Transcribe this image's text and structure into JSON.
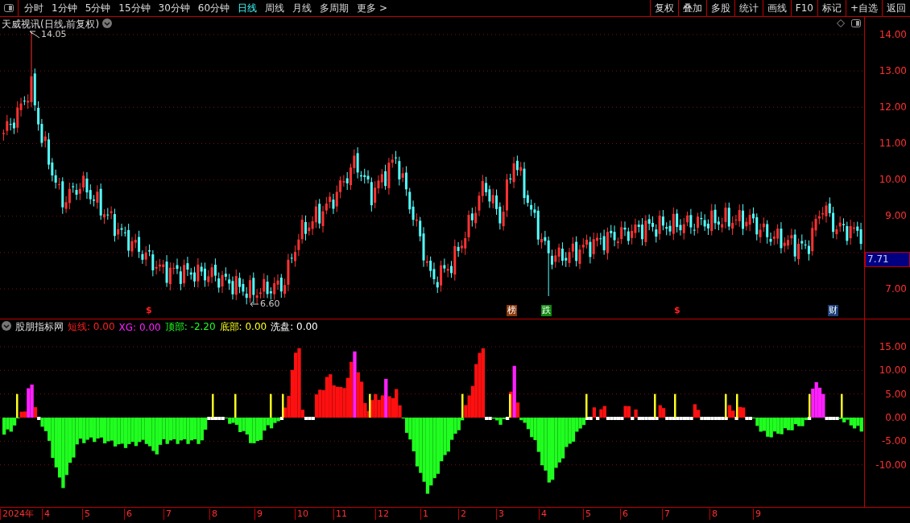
{
  "toolbar": {
    "periods": [
      {
        "label": "分时",
        "selected": false
      },
      {
        "label": "1分钟",
        "selected": false
      },
      {
        "label": "5分钟",
        "selected": false
      },
      {
        "label": "15分钟",
        "selected": false
      },
      {
        "label": "30分钟",
        "selected": false
      },
      {
        "label": "60分钟",
        "selected": false
      },
      {
        "label": "日线",
        "selected": true
      },
      {
        "label": "周线",
        "selected": false
      },
      {
        "label": "月线",
        "selected": false
      },
      {
        "label": "多周期",
        "selected": false
      },
      {
        "label": "更多 >",
        "selected": false
      }
    ],
    "actions": [
      "复权",
      "叠加",
      "多股",
      "统计",
      "画线",
      "F10",
      "标记",
      "+自选",
      "返回"
    ]
  },
  "main_chart": {
    "title": "天威视讯(日线,前复权)",
    "high_label": "14.05",
    "low_label": "6.60",
    "price_ticks": [
      "14.00",
      "13.00",
      "12.00",
      "11.00",
      "10.00",
      "9.00",
      "7.00"
    ],
    "current_price": "7.71",
    "markers": [
      {
        "kind": "sign",
        "text": "$",
        "color": "#ff2020"
      },
      {
        "kind": "badge",
        "text": "榜",
        "color": "#8b3a0c"
      },
      {
        "kind": "badge",
        "text": "跌",
        "color": "#108a10"
      },
      {
        "kind": "sign",
        "text": "$",
        "color": "#ff2020"
      },
      {
        "kind": "badge",
        "text": "财",
        "color": "#1c3f78"
      }
    ]
  },
  "indicator": {
    "name": "股朋指标网",
    "legend": [
      {
        "label": "短线:",
        "value": "0.00",
        "color": "#ff2020"
      },
      {
        "label": "XG:",
        "value": "0.00",
        "color": "#ff20ff"
      },
      {
        "label": "顶部:",
        "value": "-2.20",
        "color": "#20ff20"
      },
      {
        "label": "底部:",
        "value": "0.00",
        "color": "#ffff20"
      },
      {
        "label": "洗盘:",
        "value": "0.00",
        "color": "#ffffff"
      }
    ],
    "ticks": [
      "15.00",
      "10.00",
      "5.00",
      "0.00",
      "-5.00",
      "-10.00"
    ]
  },
  "date_axis": {
    "labels": [
      "2024年",
      "4",
      "5",
      "6",
      "7",
      "8",
      "9",
      "10",
      "11",
      "12",
      "1",
      "2",
      "3",
      "4",
      "5",
      "6",
      "7",
      "8",
      "9"
    ]
  }
}
